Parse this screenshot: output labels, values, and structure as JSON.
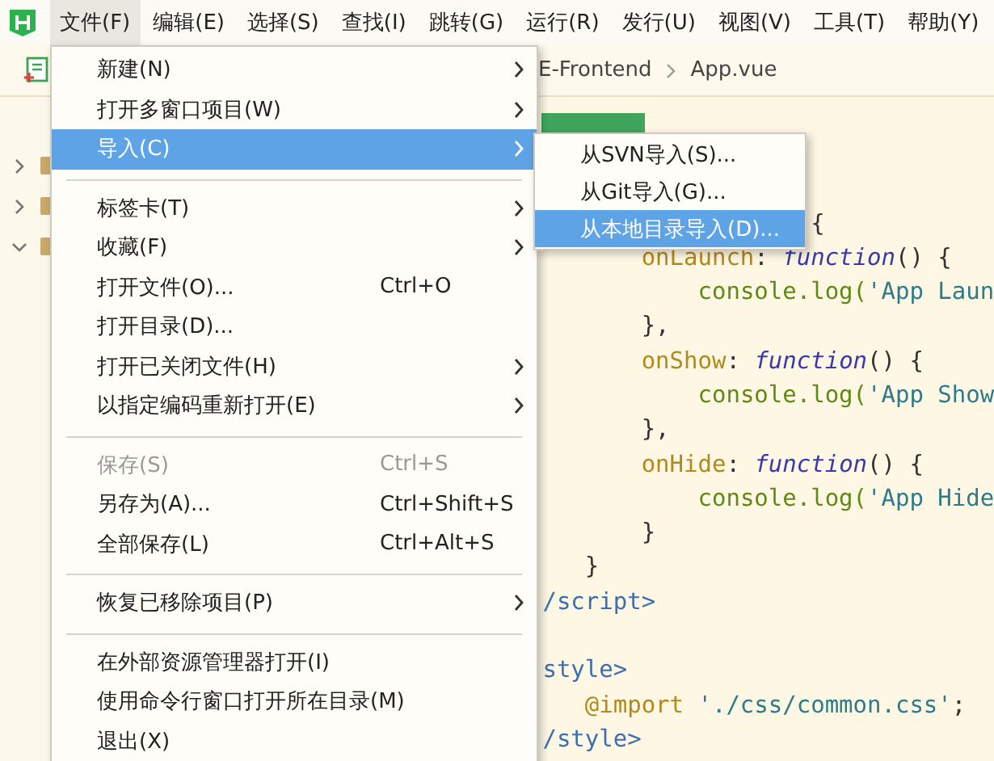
{
  "menubar": [
    {
      "label": "文件(F)",
      "selected": true
    },
    {
      "label": "编辑(E)",
      "selected": false
    },
    {
      "label": "选择(S)",
      "selected": false
    },
    {
      "label": "查找(I)",
      "selected": false
    },
    {
      "label": "跳转(G)",
      "selected": false
    },
    {
      "label": "运行(R)",
      "selected": false
    },
    {
      "label": "发行(U)",
      "selected": false
    },
    {
      "label": "视图(V)",
      "selected": false
    },
    {
      "label": "工具(T)",
      "selected": false
    },
    {
      "label": "帮助(Y)",
      "selected": false
    }
  ],
  "breadcrumb": [
    "E-Frontend",
    "App.vue"
  ],
  "tree": [
    {
      "expanded": false
    },
    {
      "expanded": false
    },
    {
      "expanded": true
    }
  ],
  "code_lines": [
    {
      "tokens": [
        {
          "kind": "punct",
          "text": "{"
        }
      ]
    },
    {
      "tokens": [
        {
          "kind": "key",
          "text": "onLaunch"
        },
        {
          "kind": "punct",
          "text": ": "
        },
        {
          "kind": "fn",
          "text": "function"
        },
        {
          "kind": "punct",
          "text": "() {"
        }
      ]
    },
    {
      "tokens": [
        {
          "kind": "obj",
          "text": "console.log("
        },
        {
          "kind": "str",
          "text": "'App Laun"
        }
      ]
    },
    {
      "tokens": [
        {
          "kind": "punct",
          "text": "},"
        }
      ]
    },
    {
      "tokens": [
        {
          "kind": "key",
          "text": "onShow"
        },
        {
          "kind": "punct",
          "text": ": "
        },
        {
          "kind": "fn",
          "text": "function"
        },
        {
          "kind": "punct",
          "text": "() {"
        }
      ]
    },
    {
      "tokens": [
        {
          "kind": "obj",
          "text": "console.log("
        },
        {
          "kind": "str",
          "text": "'App Show"
        }
      ]
    },
    {
      "tokens": [
        {
          "kind": "punct",
          "text": "},"
        }
      ]
    },
    {
      "tokens": [
        {
          "kind": "key",
          "text": "onHide"
        },
        {
          "kind": "punct",
          "text": ": "
        },
        {
          "kind": "fn",
          "text": "function"
        },
        {
          "kind": "punct",
          "text": "() {"
        }
      ]
    },
    {
      "tokens": [
        {
          "kind": "obj",
          "text": "console.log("
        },
        {
          "kind": "str",
          "text": "'App Hide"
        }
      ]
    },
    {
      "tokens": [
        {
          "kind": "punct",
          "text": "}"
        }
      ]
    },
    {
      "tokens": [
        {
          "kind": "punct",
          "text": "}"
        }
      ]
    },
    {
      "tokens": [
        {
          "kind": "tag",
          "text": "/script>"
        }
      ]
    },
    {
      "tokens": [
        {
          "kind": "tag",
          "text": "style>"
        }
      ]
    },
    {
      "tokens": [
        {
          "kind": "key",
          "text": "@import"
        },
        {
          "kind": "str",
          "text": " './css/common.css'"
        },
        {
          "kind": "punct",
          "text": ";"
        }
      ]
    },
    {
      "tokens": [
        {
          "kind": "tag",
          "text": "/style>"
        }
      ]
    }
  ],
  "file_menu": [
    {
      "kind": "item",
      "label": "新建(N)",
      "submenu": true,
      "selected": false,
      "disabled": false
    },
    {
      "kind": "item",
      "label": "打开多窗口项目(W)",
      "submenu": true,
      "selected": false,
      "disabled": false
    },
    {
      "kind": "item",
      "label": "导入(C)",
      "submenu": true,
      "selected": true,
      "disabled": false
    },
    {
      "kind": "separator"
    },
    {
      "kind": "item",
      "label": "标签卡(T)",
      "submenu": true,
      "selected": false,
      "disabled": false
    },
    {
      "kind": "item",
      "label": "收藏(F)",
      "submenu": true,
      "selected": false,
      "disabled": false
    },
    {
      "kind": "item",
      "label": "打开文件(O)...",
      "shortcut": "Ctrl+O",
      "submenu": false,
      "selected": false,
      "disabled": false
    },
    {
      "kind": "item",
      "label": "打开目录(D)...",
      "submenu": false,
      "selected": false,
      "disabled": false
    },
    {
      "kind": "item",
      "label": "打开已关闭文件(H)",
      "submenu": true,
      "selected": false,
      "disabled": false
    },
    {
      "kind": "item",
      "label": "以指定编码重新打开(E)",
      "submenu": true,
      "selected": false,
      "disabled": false
    },
    {
      "kind": "separator"
    },
    {
      "kind": "item",
      "label": "保存(S)",
      "shortcut": "Ctrl+S",
      "submenu": false,
      "selected": false,
      "disabled": true
    },
    {
      "kind": "item",
      "label": "另存为(A)...",
      "shortcut": "Ctrl+Shift+S",
      "submenu": false,
      "selected": false,
      "disabled": false
    },
    {
      "kind": "item",
      "label": "全部保存(L)",
      "shortcut": "Ctrl+Alt+S",
      "submenu": false,
      "selected": false,
      "disabled": false
    },
    {
      "kind": "separator"
    },
    {
      "kind": "item",
      "label": "恢复已移除项目(P)",
      "submenu": true,
      "selected": false,
      "disabled": false
    },
    {
      "kind": "separator"
    },
    {
      "kind": "item",
      "label": "在外部资源管理器打开(I)",
      "submenu": false,
      "selected": false,
      "disabled": false
    },
    {
      "kind": "item",
      "label": "使用命令行窗口打开所在目录(M)",
      "submenu": false,
      "selected": false,
      "disabled": false
    },
    {
      "kind": "item",
      "label": "退出(X)",
      "submenu": false,
      "selected": false,
      "disabled": false
    }
  ],
  "import_submenu": [
    {
      "label": "从SVN导入(S)...",
      "selected": false
    },
    {
      "label": "从Git导入(G)...",
      "selected": false
    },
    {
      "label": "从本地目录导入(D)...",
      "selected": true
    }
  ]
}
